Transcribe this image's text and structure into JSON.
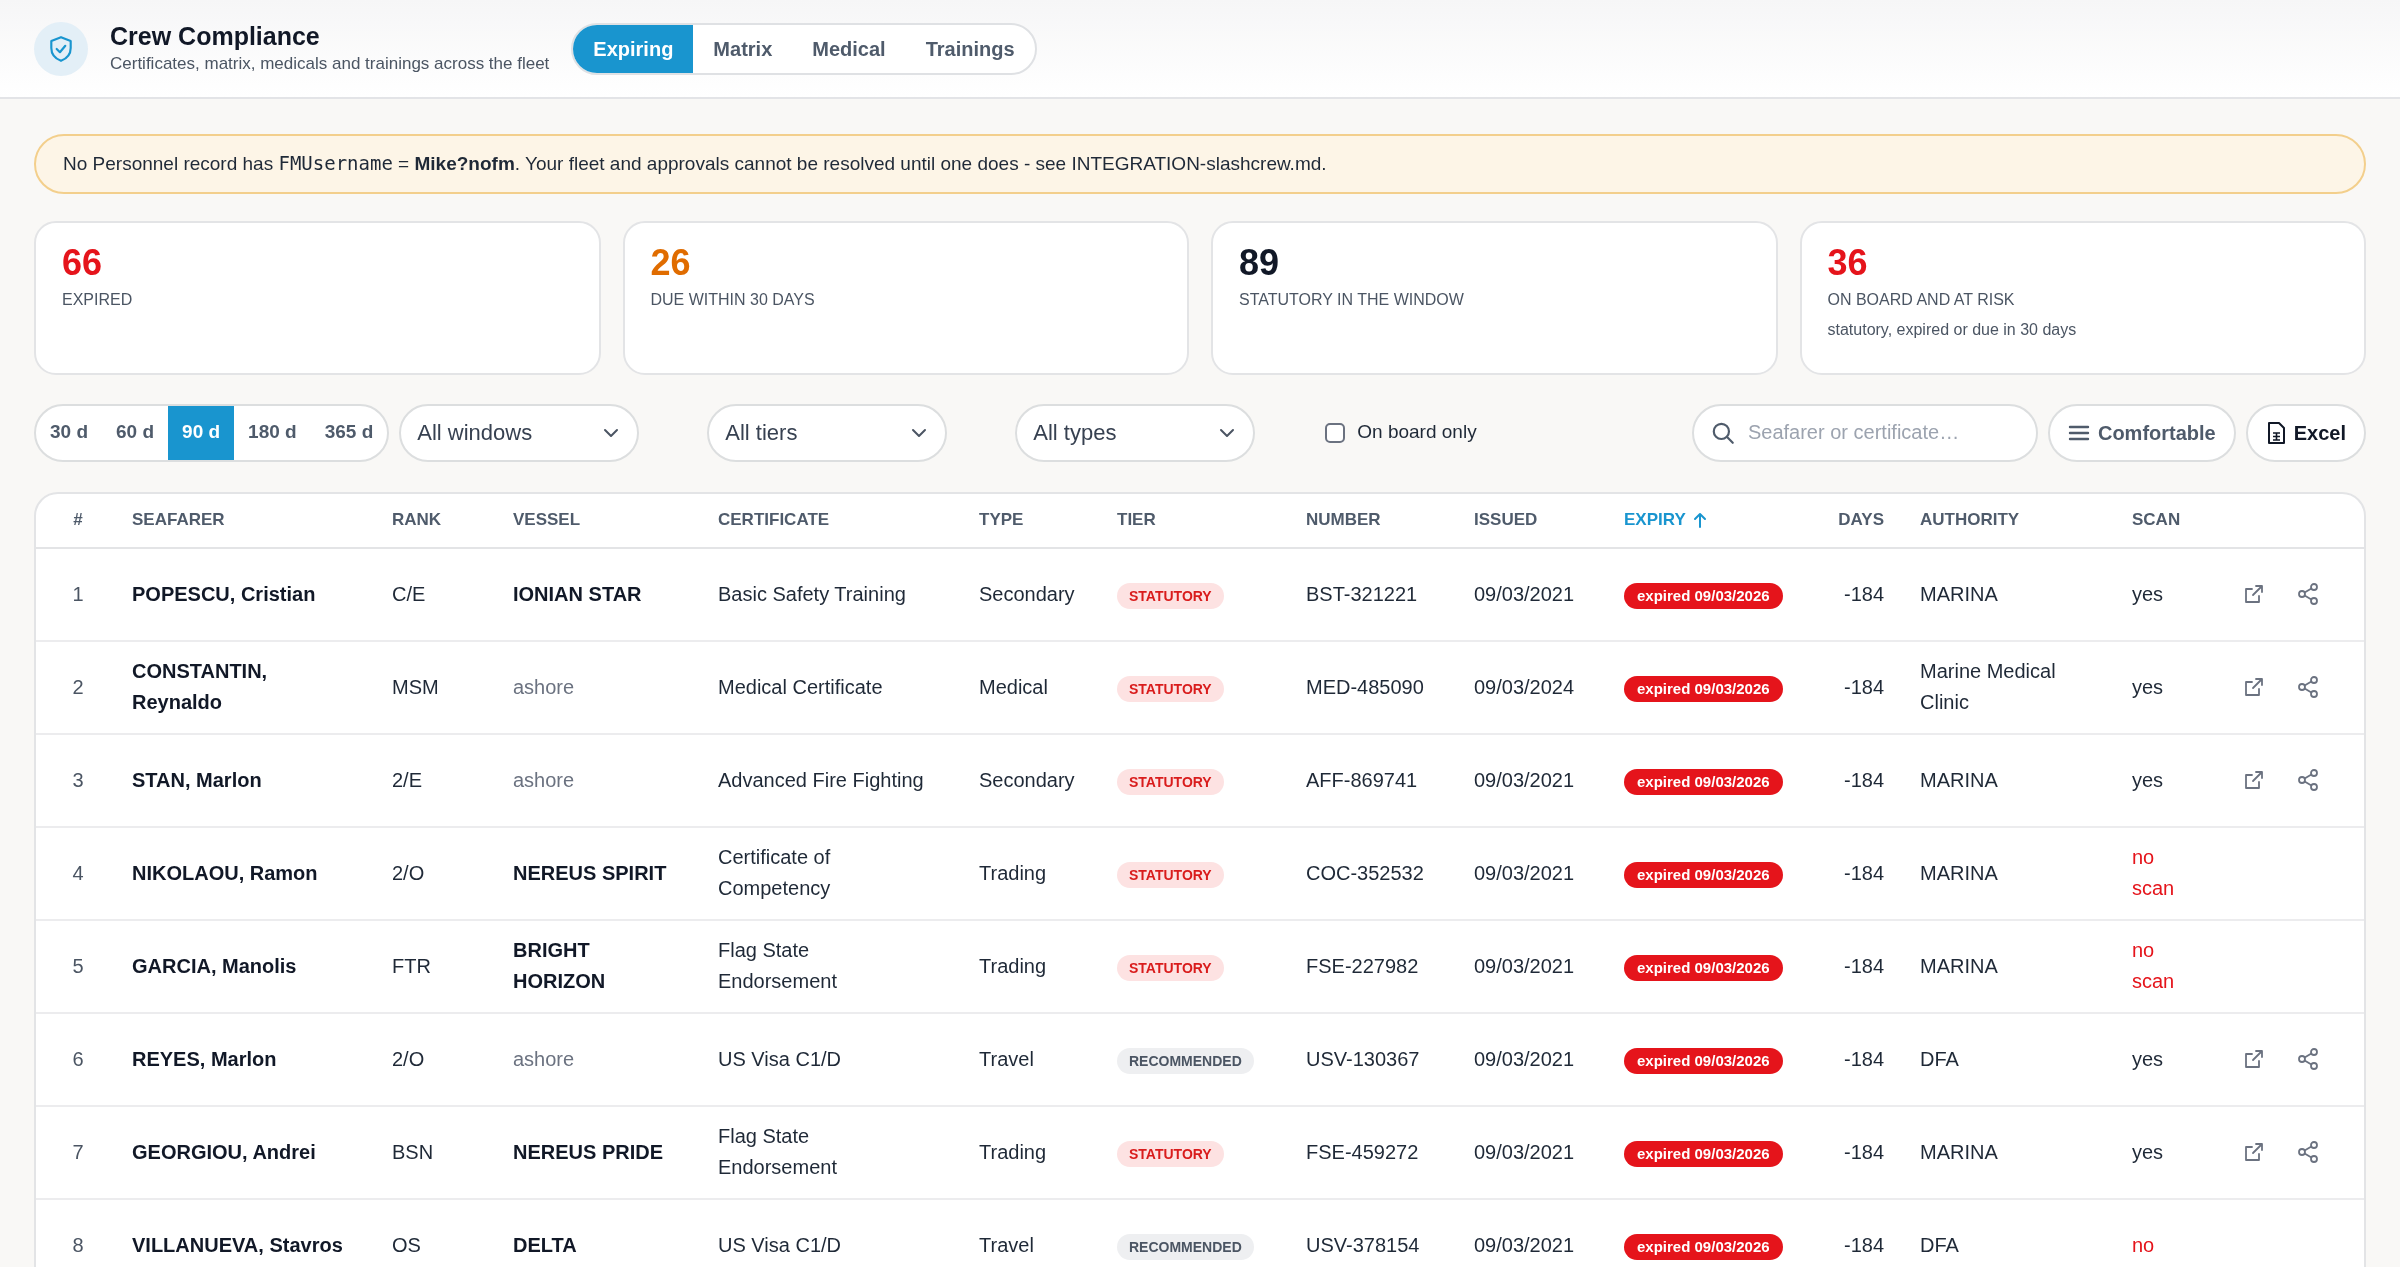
{
  "header": {
    "title": "Crew Compliance",
    "subtitle": "Certificates, matrix, medicals and trainings across the fleet"
  },
  "tabs": [
    {
      "label": "Expiring",
      "selected": true
    },
    {
      "label": "Matrix",
      "selected": false
    },
    {
      "label": "Medical",
      "selected": false
    },
    {
      "label": "Trainings",
      "selected": false
    }
  ],
  "banner": [
    {
      "kind": "text",
      "text": "No Personnel record has "
    },
    {
      "kind": "code",
      "text": "FMUsername"
    },
    {
      "kind": "text",
      "text": " = "
    },
    {
      "kind": "bold",
      "text": "Mike?nofm"
    },
    {
      "kind": "text",
      "text": ". Your fleet and approvals cannot be resolved until one does - see INTEGRATION-slashcrew.md."
    }
  ],
  "stats": [
    {
      "value": "66",
      "label": "EXPIRED",
      "color": "#e5141b"
    },
    {
      "value": "26",
      "label": "DUE WITHIN 30 DAYS",
      "color": "#e06c00"
    },
    {
      "value": "89",
      "label": "STATUTORY IN THE WINDOW",
      "color": "#111827"
    },
    {
      "value": "36",
      "label": "ON BOARD AND AT RISK",
      "note": "statutory, expired or due in 30 days",
      "color": "#e5141b"
    }
  ],
  "windows": [
    {
      "label": "30 d",
      "selected": false
    },
    {
      "label": "60 d",
      "selected": false
    },
    {
      "label": "90 d",
      "selected": true
    },
    {
      "label": "180 d",
      "selected": false
    },
    {
      "label": "365 d",
      "selected": false
    }
  ],
  "selects": [
    {
      "value": "All windows"
    },
    {
      "value": "All tiers"
    },
    {
      "value": "All types"
    }
  ],
  "on_board_only": {
    "label": "On board only",
    "checked": false
  },
  "search": {
    "placeholder": "Seafarer or certificate…"
  },
  "buttons": [
    {
      "kind": "density",
      "label": "Comfortable"
    },
    {
      "kind": "excel",
      "label": "Excel"
    }
  ],
  "table": {
    "columns": [
      {
        "label": "#",
        "sorted": false
      },
      {
        "label": "SEAFARER",
        "sorted": false
      },
      {
        "label": "RANK",
        "sorted": false
      },
      {
        "label": "VESSEL",
        "sorted": false
      },
      {
        "label": "CERTIFICATE",
        "sorted": false
      },
      {
        "label": "TYPE",
        "sorted": false
      },
      {
        "label": "TIER",
        "sorted": false
      },
      {
        "label": "NUMBER",
        "sorted": false
      },
      {
        "label": "ISSUED",
        "sorted": false
      },
      {
        "label": "EXPIRY",
        "sorted": true
      },
      {
        "label": "DAYS",
        "sorted": false
      },
      {
        "label": "AUTHORITY",
        "sorted": false
      },
      {
        "label": "SCAN",
        "sorted": false
      }
    ],
    "rows": [
      {
        "n": "1",
        "seafarer": "POPESCU, Cristian",
        "rank": "C/E",
        "vessel": "IONIAN STAR",
        "ashore": false,
        "certificate": "Basic Safety Training",
        "type": "Secondary",
        "tier": {
          "label": "STATUTORY",
          "kind": "statutory"
        },
        "number": "BST-321221",
        "issued": "09/03/2021",
        "expiry": "expired 09/03/2026",
        "days": "-184",
        "authority": "MARINA",
        "scan": "yes",
        "scanned": true
      },
      {
        "n": "2",
        "seafarer": "CONSTANTIN, Reynaldo",
        "rank": "MSM",
        "vessel": "ashore",
        "ashore": true,
        "certificate": "Medical Certificate",
        "type": "Medical",
        "tier": {
          "label": "STATUTORY",
          "kind": "statutory"
        },
        "number": "MED-485090",
        "issued": "09/03/2024",
        "expiry": "expired 09/03/2026",
        "days": "-184",
        "authority": "Marine Medical Clinic",
        "scan": "yes",
        "scanned": true
      },
      {
        "n": "3",
        "seafarer": "STAN, Marlon",
        "rank": "2/E",
        "vessel": "ashore",
        "ashore": true,
        "certificate": "Advanced Fire Fighting",
        "type": "Secondary",
        "tier": {
          "label": "STATUTORY",
          "kind": "statutory"
        },
        "number": "AFF-869741",
        "issued": "09/03/2021",
        "expiry": "expired 09/03/2026",
        "days": "-184",
        "authority": "MARINA",
        "scan": "yes",
        "scanned": true
      },
      {
        "n": "4",
        "seafarer": "NIKOLAOU, Ramon",
        "rank": "2/O",
        "vessel": "NEREUS SPIRIT",
        "ashore": false,
        "certificate": "Certificate of Competency",
        "type": "Trading",
        "tier": {
          "label": "STATUTORY",
          "kind": "statutory"
        },
        "number": "COC-352532",
        "issued": "09/03/2021",
        "expiry": "expired 09/03/2026",
        "days": "-184",
        "authority": "MARINA",
        "scan": "no scan",
        "scanned": false
      },
      {
        "n": "5",
        "seafarer": "GARCIA, Manolis",
        "rank": "FTR",
        "vessel": "BRIGHT HORIZON",
        "ashore": false,
        "certificate": "Flag State Endorsement",
        "type": "Trading",
        "tier": {
          "label": "STATUTORY",
          "kind": "statutory"
        },
        "number": "FSE-227982",
        "issued": "09/03/2021",
        "expiry": "expired 09/03/2026",
        "days": "-184",
        "authority": "MARINA",
        "scan": "no scan",
        "scanned": false
      },
      {
        "n": "6",
        "seafarer": "REYES, Marlon",
        "rank": "2/O",
        "vessel": "ashore",
        "ashore": true,
        "certificate": "US Visa C1/D",
        "type": "Travel",
        "tier": {
          "label": "RECOMMENDED",
          "kind": "recommended"
        },
        "number": "USV-130367",
        "issued": "09/03/2021",
        "expiry": "expired 09/03/2026",
        "days": "-184",
        "authority": "DFA",
        "scan": "yes",
        "scanned": true
      },
      {
        "n": "7",
        "seafarer": "GEORGIOU, Andrei",
        "rank": "BSN",
        "vessel": "NEREUS PRIDE",
        "ashore": false,
        "certificate": "Flag State Endorsement",
        "type": "Trading",
        "tier": {
          "label": "STATUTORY",
          "kind": "statutory"
        },
        "number": "FSE-459272",
        "issued": "09/03/2021",
        "expiry": "expired 09/03/2026",
        "days": "-184",
        "authority": "MARINA",
        "scan": "yes",
        "scanned": true
      },
      {
        "n": "8",
        "seafarer": "VILLANUEVA, Stavros",
        "rank": "OS",
        "vessel": "DELTA",
        "ashore": false,
        "certificate": "US Visa C1/D",
        "type": "Travel",
        "tier": {
          "label": "RECOMMENDED",
          "kind": "recommended"
        },
        "number": "USV-378154",
        "issued": "09/03/2021",
        "expiry": "expired 09/03/2026",
        "days": "-184",
        "authority": "DFA",
        "scan": "no",
        "scanned": false
      }
    ]
  }
}
